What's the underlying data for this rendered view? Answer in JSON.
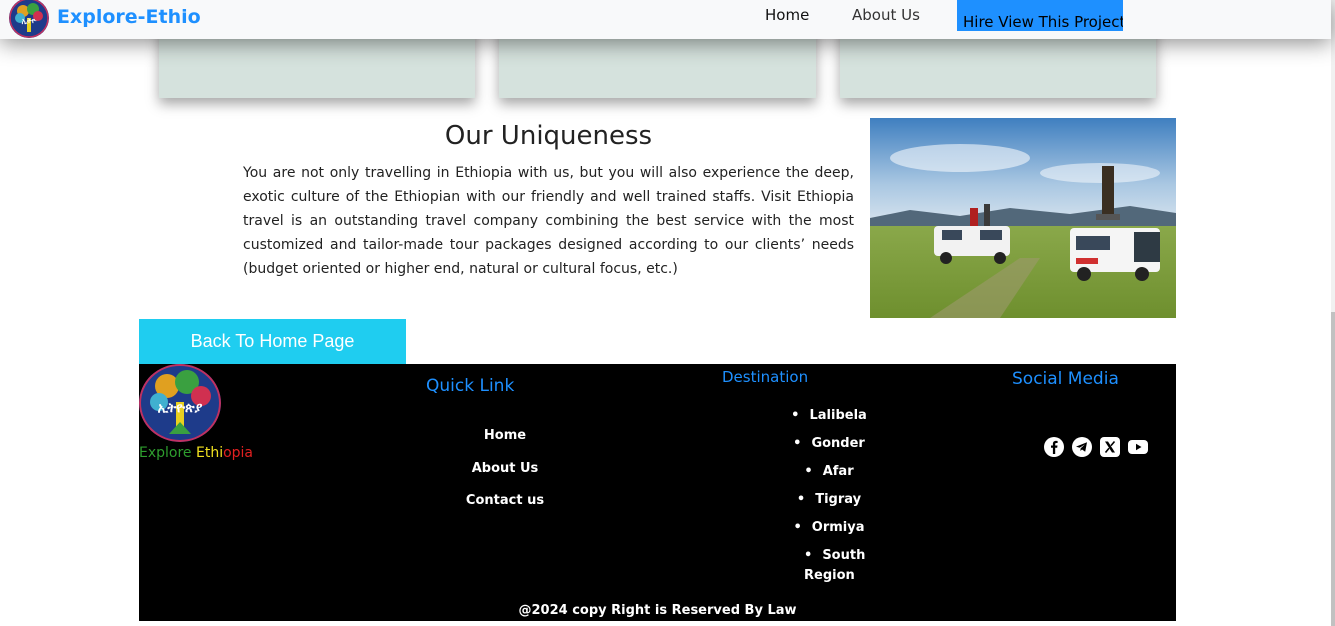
{
  "navbar": {
    "brand": "Explore-Ethio",
    "links": [
      "Home",
      "About Us"
    ],
    "hire_button": "Hire View This Project"
  },
  "uniqueness": {
    "title": "Our Uniqueness",
    "text": "You are not only travelling in Ethiopia with us, but you will also experience the deep, exotic culture of the Ethiopian with our friendly and well trained staffs. Visit Ethiopia travel is an outstanding travel company combining the best service with the most customized and tailor-made tour packages designed according to our clients’ needs (budget oriented or higher end, natural or cultural focus, etc.)"
  },
  "back_button": "Back To Home Page",
  "footer": {
    "logo_text": "ኢትዮጵያ",
    "brand_parts": [
      "Explore ",
      "Ethi",
      "opia"
    ],
    "quick_link": {
      "title": "Quick Link",
      "items": [
        "Home",
        "About Us",
        "Contact us"
      ]
    },
    "destination": {
      "title": "Destination",
      "items": [
        "Lalibela",
        "Gonder",
        "Afar",
        "Tigray",
        "Ormiya",
        "South Region"
      ]
    },
    "social": {
      "title": "Social Media",
      "icons": [
        "facebook-icon",
        "telegram-icon",
        "x-icon",
        "youtube-icon"
      ]
    },
    "copyright": "@2024 copy Right is Reserved By Law"
  },
  "colors": {
    "brand_blue": "#1e90ff",
    "back_button": "#1fcdf0",
    "card": "#d5e2dd",
    "footer_bg": "#000000",
    "flag_green": "#2e9e2e",
    "flag_yellow": "#f0e020",
    "flag_red": "#e02020"
  }
}
